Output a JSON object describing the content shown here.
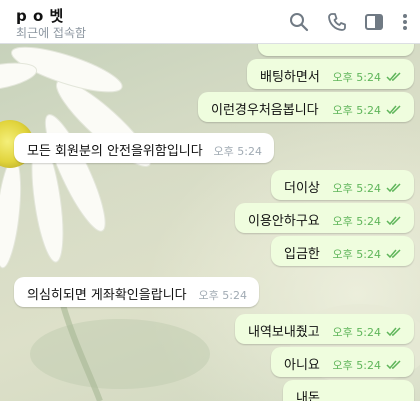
{
  "header": {
    "title": "p o 벳",
    "status": "최근에 접속함",
    "icons": [
      "search-icon",
      "phone-icon",
      "sidebar-icon",
      "more-icon"
    ]
  },
  "colors": {
    "outgoing_bubble": "#effdde",
    "incoming_bubble": "#ffffff",
    "read_check": "#5fb55a",
    "timestamp_in": "#a0aab3"
  },
  "messages": [
    {
      "text": "",
      "time": "",
      "outgoing": true
    },
    {
      "text": "배팅하면서",
      "time": "오후 5:24",
      "outgoing": true
    },
    {
      "text": "이런경우처음봅니다",
      "time": "오후 5:24",
      "outgoing": true
    },
    {
      "text": "모든 회원분의 안전을위함입니다",
      "time": "오후 5:24",
      "outgoing": false
    },
    {
      "text": "더이상",
      "time": "오후 5:24",
      "outgoing": true
    },
    {
      "text": "이용안하구요",
      "time": "오후 5:24",
      "outgoing": true
    },
    {
      "text": "입금한",
      "time": "오후 5:24",
      "outgoing": true
    },
    {
      "text": "의심히되면 게좌확인을랍니다",
      "time": "오후 5:24",
      "outgoing": false
    },
    {
      "text": "내역보내줬고",
      "time": "오후 5:24",
      "outgoing": true
    },
    {
      "text": "아니요",
      "time": "오후 5:24",
      "outgoing": true
    },
    {
      "text": "내돈",
      "time": "",
      "outgoing": true
    }
  ]
}
